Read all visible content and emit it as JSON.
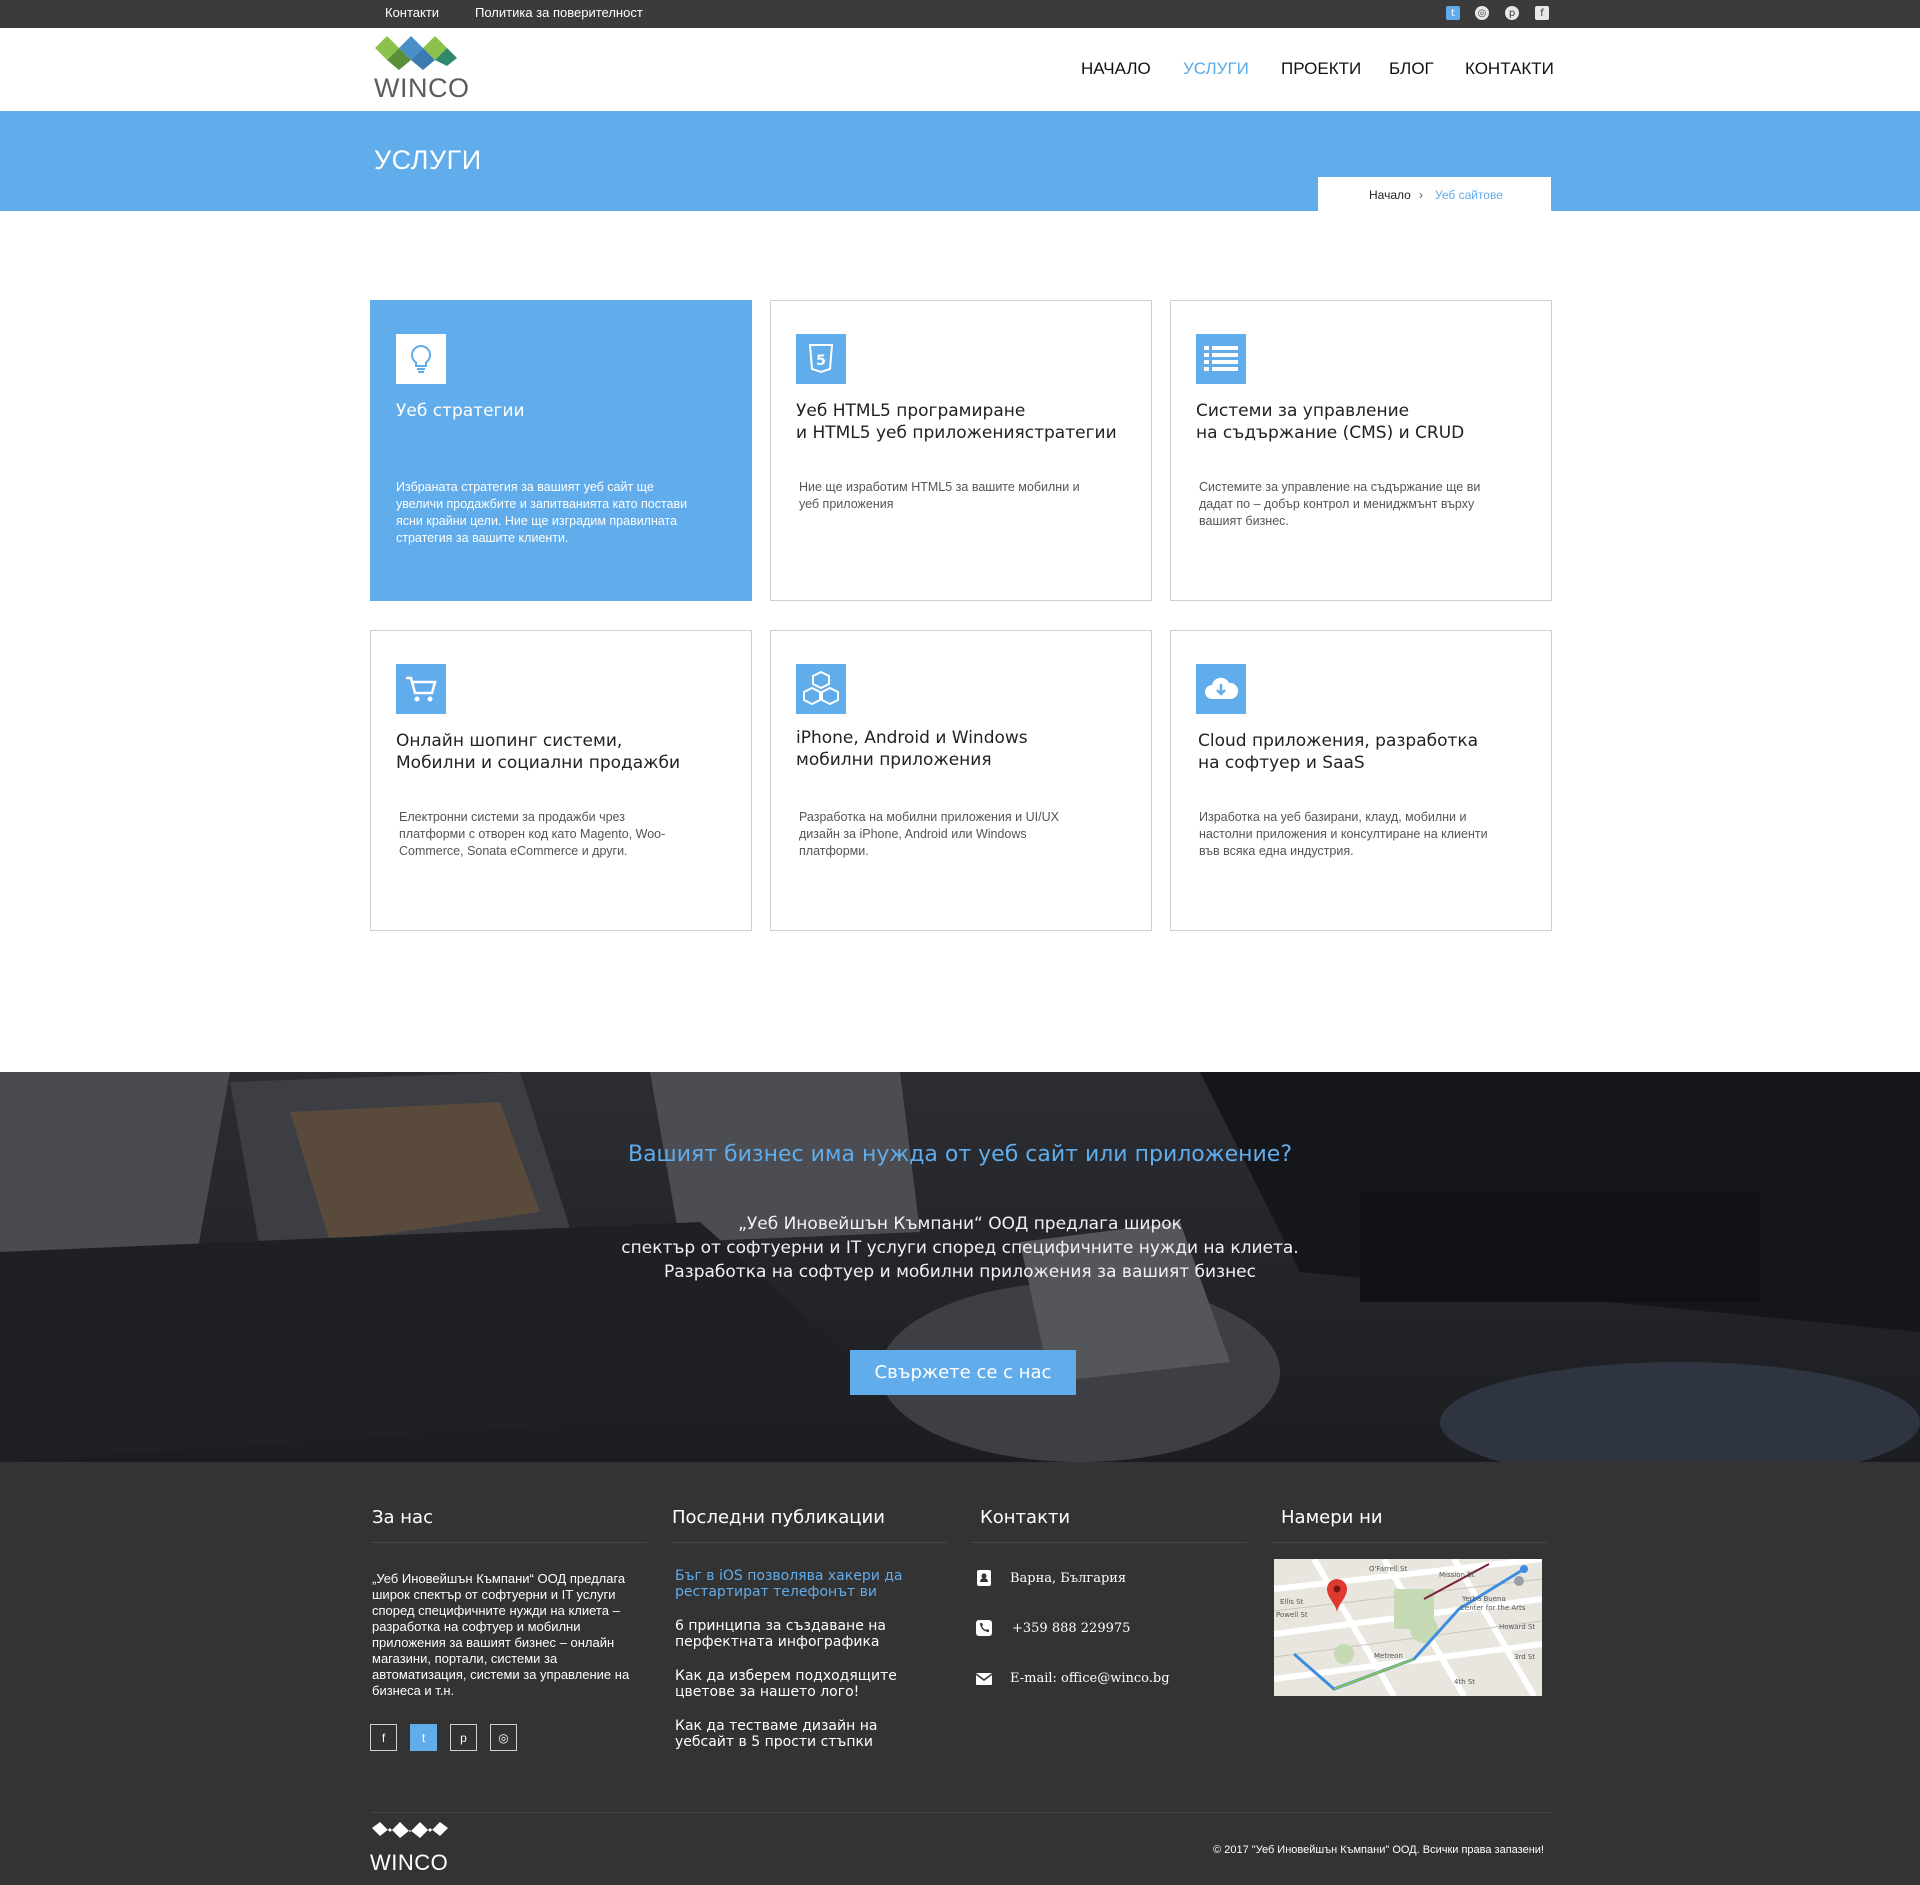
{
  "topbar": {
    "links": [
      "Контакти",
      "Политика за поверителност"
    ],
    "social_icons": [
      "twitter-icon",
      "dribbble-icon",
      "pinterest-icon",
      "facebook-icon"
    ]
  },
  "header": {
    "logo_text": "WINCO",
    "nav": [
      "НАЧАЛО",
      "УСЛУГИ",
      "ПРОЕКТИ",
      "БЛОГ",
      "КОНТАКТИ"
    ],
    "active_nav": "УСЛУГИ"
  },
  "page_title": "УСЛУГИ",
  "breadcrumb": {
    "home": "Начало",
    "separator": "›",
    "current": "Уеб сайтове"
  },
  "services": [
    {
      "icon": "lightbulb-icon",
      "title": "Уеб стратегии",
      "description": "Избраната стратегия за вашият уеб сайт ще увеличи продажбите и запитванията като постави ясни крайни цели. Ние ще изградим правилната стратегия за вашите клиенти."
    },
    {
      "icon": "html5-icon",
      "title": "Уеб HTML5 програмиране\nи HTML5 уеб приложениястратегии",
      "description": "Ние ще изработим HTML5 за вашите мобилни и уеб приложения"
    },
    {
      "icon": "list-icon",
      "title": "Системи за управление\nна съдържание (CMS) и CRUD",
      "description": "Системите за управление на съдържание ще ви дадат по – добър контрол и мениджмънт върху вашият бизнес."
    },
    {
      "icon": "shopping-cart-icon",
      "title": "Онлайн шопинг системи,\nМобилни и социални продажби",
      "description": "Електронни системи за продажби чрез платформи с отворен код като Magento, Woo-Commerce, Sonata eCommerce и други."
    },
    {
      "icon": "cubes-icon",
      "title": "iPhone, Android и Windows\nмобилни приложения",
      "description": "Разработка на мобилни приложения и UI/UX дизайн за iPhone, Android или Windows платформи."
    },
    {
      "icon": "cloud-download-icon",
      "title": "Cloud приложения, разработка\nна софтуер и SaaS",
      "description": "Изработка на уеб базирани, клауд, мобилни и настолни приложения и консултиране на клиенти във всяка една индустрия."
    }
  ],
  "cta": {
    "heading": "Вашият бизнес има нужда от уеб сайт или приложение?",
    "lines": [
      "„Уеб Иновейшън Къмпани“ ООД предлага широк",
      "спектър от софтуерни и IT услуги според специфичните нужди на клиета.",
      "Разработка на софтуер и мобилни приложения за вашият бизнес"
    ],
    "button": "Свържете се с нас"
  },
  "footer": {
    "about": {
      "heading": "За нас",
      "text": "„Уеб Иновейшън Къмпани“ ООД предлага широк спектър от софтуерни и IT услуги според специфичните нужди на клиета – разработка на софтуер и мобилни приложения за вашият бизнес – онлайн магазини, портали, системи за автоматизация, системи за управление на бизнеса и т.н.",
      "social_icons": [
        "facebook-icon",
        "twitter-icon",
        "pinterest-icon",
        "dribbble-icon"
      ]
    },
    "posts": {
      "heading": "Последни публикации",
      "items": [
        "Бъг в iOS позволява хакери да рестартират телефонът ви",
        "6 принципа за създаване на перфектната инфографика",
        "Как да изберем подходящите цветове за нашето лого!",
        "Как да тестваме дизайн на уебсайт в 5 прости стъпки"
      ]
    },
    "contacts": {
      "heading": "Контакти",
      "address": "Варна, България",
      "phone": "+359 888 229975",
      "email": "E-mail: office@winco.bg"
    },
    "map": {
      "heading": "Намери ни",
      "labels": [
        "Powell St",
        "Yerba Buena",
        "Center for the Arts",
        "Metreon",
        "Ellis St",
        "O'Farrell St",
        "Mission St",
        "Howard St",
        "3rd St",
        "4th St"
      ]
    },
    "logo_text": "WINCO",
    "copyright": "© 2017 \"Уеб Иновейшън Къмпани\" ООД. Всички права запазени!"
  },
  "colors": {
    "accent": "#61acea",
    "topbar": "#3b3b3b",
    "footer": "#333333",
    "logo_green": "#8bc34a",
    "logo_blue": "#4a90c8"
  }
}
